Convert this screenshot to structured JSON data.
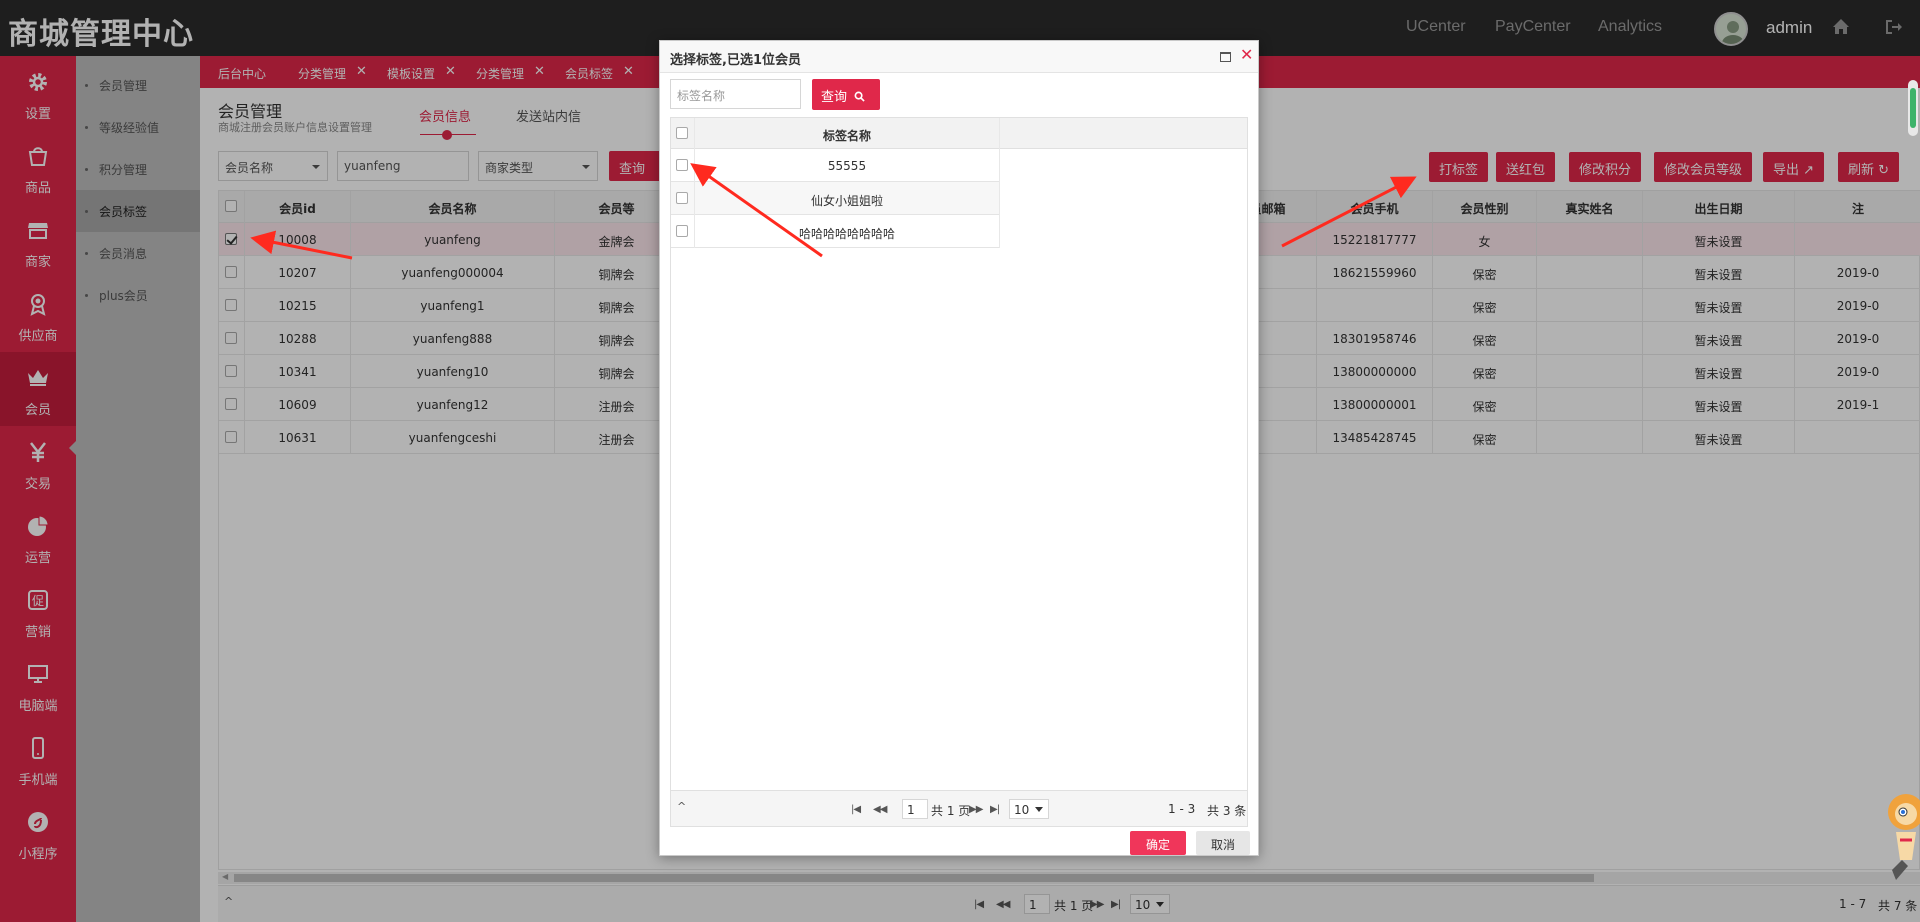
{
  "app": {
    "title": "商城管理中心"
  },
  "topbar": {
    "links": [
      "UCenter",
      "PayCenter",
      "Analytics"
    ],
    "user": "admin"
  },
  "nav": {
    "items": [
      {
        "label": "设置",
        "icon": "gear-icon"
      },
      {
        "label": "商品",
        "icon": "shopping-bag-icon"
      },
      {
        "label": "商家",
        "icon": "store-icon"
      },
      {
        "label": "供应商",
        "icon": "supplier-badge-icon"
      },
      {
        "label": "会员",
        "icon": "crown-icon",
        "active": true
      },
      {
        "label": "交易",
        "icon": "yen-icon"
      },
      {
        "label": "运营",
        "icon": "pie-chart-icon"
      },
      {
        "label": "营销",
        "icon": "promo-icon"
      },
      {
        "label": "电脑端",
        "icon": "monitor-icon"
      },
      {
        "label": "手机端",
        "icon": "mobile-icon"
      },
      {
        "label": "小程序",
        "icon": "mini-program-icon"
      }
    ]
  },
  "subnav": {
    "items": [
      "会员管理",
      "等级经验值",
      "积分管理",
      "会员标签",
      "会员消息",
      "plus会员"
    ],
    "active_index": 3
  },
  "tabs": [
    "后台中心",
    "分类管理",
    "模板设置",
    "分类管理",
    "会员标签"
  ],
  "page": {
    "title": "会员管理",
    "subtitle": "商城注册会员账户信息设置管理",
    "subtabs": [
      "会员信息",
      "发送站内信"
    ]
  },
  "filters": {
    "field_select": "会员名称",
    "keyword": "yuanfeng",
    "merchant_type": "商家类型",
    "query_label": "查询"
  },
  "actions": [
    "打标签",
    "送红包",
    "修改积分",
    "修改会员等级",
    "导出",
    "刷新"
  ],
  "member_table": {
    "columns": [
      "会员id",
      "会员名称",
      "会员等",
      "员邮箱",
      "会员手机",
      "会员性别",
      "真实姓名",
      "出生日期",
      "注"
    ],
    "rows": [
      {
        "id": "10008",
        "name": "yuanfeng",
        "level": "金牌会",
        "phone": "15221817777",
        "gender": "女",
        "birth": "暂未设置",
        "extra": "",
        "checked": true
      },
      {
        "id": "10207",
        "name": "yuanfeng000004",
        "level": "铜牌会",
        "phone": "18621559960",
        "gender": "保密",
        "birth": "暂未设置",
        "extra": "2019-0"
      },
      {
        "id": "10215",
        "name": "yuanfeng1",
        "level": "铜牌会",
        "phone": "",
        "gender": "保密",
        "birth": "暂未设置",
        "extra": "2019-0"
      },
      {
        "id": "10288",
        "name": "yuanfeng888",
        "level": "铜牌会",
        "phone": "18301958746",
        "gender": "保密",
        "birth": "暂未设置",
        "extra": "2019-0"
      },
      {
        "id": "10341",
        "name": "yuanfeng10",
        "level": "铜牌会",
        "phone": "13800000000",
        "gender": "保密",
        "birth": "暂未设置",
        "extra": "2019-0"
      },
      {
        "id": "10609",
        "name": "yuanfeng12",
        "level": "注册会",
        "phone": "13800000001",
        "gender": "保密",
        "birth": "暂未设置",
        "extra": "2019-1"
      },
      {
        "id": "10631",
        "name": "yuanfengceshi",
        "level": "注册会",
        "phone": "13485428745",
        "gender": "保密",
        "birth": "暂未设置",
        "extra": ""
      }
    ],
    "pager": {
      "page": "1",
      "total_pages": "共 1 页",
      "page_size": "10",
      "range": "1 - 7",
      "total": "共 7 条"
    }
  },
  "dialog": {
    "title": "选择标签,已选1位会员",
    "search_placeholder": "标签名称",
    "query_label": "查询",
    "column": "标签名称",
    "tags": [
      "55555",
      "仙女小姐姐啦",
      "哈哈哈哈哈哈哈哈"
    ],
    "pager": {
      "page": "1",
      "total_pages": "共 1 页",
      "page_size": "10",
      "range": "1 - 3",
      "total": "共 3 条"
    },
    "ok_label": "确定",
    "cancel_label": "取消"
  },
  "colors": {
    "brand": "#e0284a",
    "header": "#2b2b2b",
    "subnav": "#bdbdbd",
    "annotation": "#ff2a1f"
  }
}
